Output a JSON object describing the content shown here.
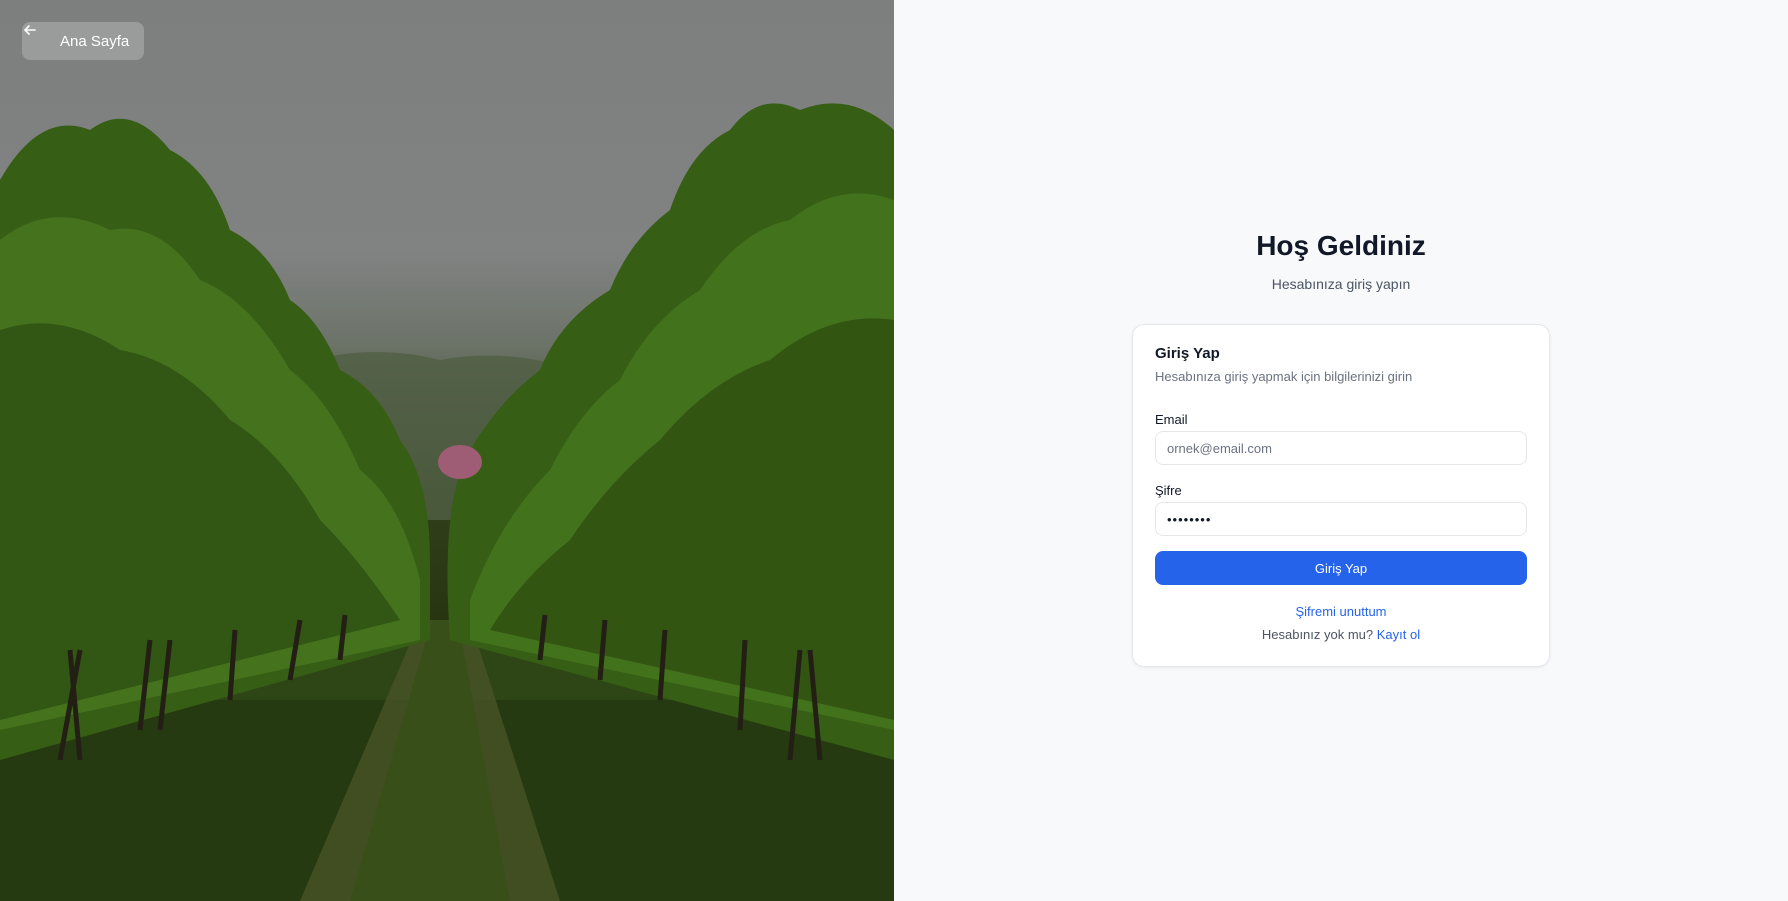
{
  "back_button": {
    "label": "Ana Sayfa",
    "icon": "arrow-left-icon"
  },
  "welcome": {
    "title": "Hoş Geldiniz",
    "subtitle": "Hesabınıza giriş yapın"
  },
  "card": {
    "title": "Giriş Yap",
    "description": "Hesabınıza giriş yapmak için bilgilerinizi girin",
    "email_label": "Email",
    "email_placeholder": "ornek@email.com",
    "email_value": "",
    "password_label": "Şifre",
    "password_value": "••••••••",
    "submit_label": "Giriş Yap",
    "forgot_label": "Şifremi unuttum",
    "signup_prompt": "Hesabınız yok mu?",
    "signup_link": "Kayıt ol"
  },
  "colors": {
    "accent": "#2563eb",
    "page_bg": "#f8f9fb",
    "title": "#111827"
  }
}
